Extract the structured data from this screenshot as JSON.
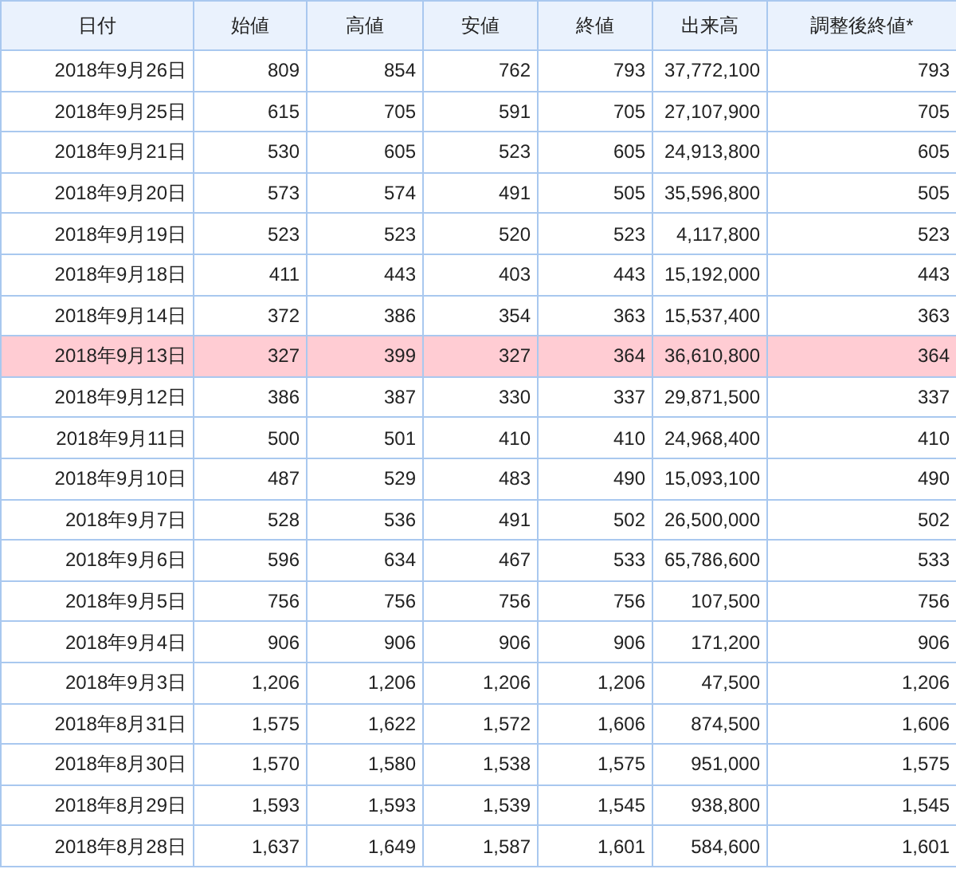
{
  "table": {
    "columns": [
      "日付",
      "始値",
      "高値",
      "安値",
      "終値",
      "出来高",
      "調整後終値*"
    ],
    "rows": [
      {
        "cells": [
          "2018年9月26日",
          "809",
          "854",
          "762",
          "793",
          "37,772,100",
          "793"
        ],
        "highlighted": false
      },
      {
        "cells": [
          "2018年9月25日",
          "615",
          "705",
          "591",
          "705",
          "27,107,900",
          "705"
        ],
        "highlighted": false
      },
      {
        "cells": [
          "2018年9月21日",
          "530",
          "605",
          "523",
          "605",
          "24,913,800",
          "605"
        ],
        "highlighted": false
      },
      {
        "cells": [
          "2018年9月20日",
          "573",
          "574",
          "491",
          "505",
          "35,596,800",
          "505"
        ],
        "highlighted": false
      },
      {
        "cells": [
          "2018年9月19日",
          "523",
          "523",
          "520",
          "523",
          "4,117,800",
          "523"
        ],
        "highlighted": false
      },
      {
        "cells": [
          "2018年9月18日",
          "411",
          "443",
          "403",
          "443",
          "15,192,000",
          "443"
        ],
        "highlighted": false
      },
      {
        "cells": [
          "2018年9月14日",
          "372",
          "386",
          "354",
          "363",
          "15,537,400",
          "363"
        ],
        "highlighted": false
      },
      {
        "cells": [
          "2018年9月13日",
          "327",
          "399",
          "327",
          "364",
          "36,610,800",
          "364"
        ],
        "highlighted": true
      },
      {
        "cells": [
          "2018年9月12日",
          "386",
          "387",
          "330",
          "337",
          "29,871,500",
          "337"
        ],
        "highlighted": false
      },
      {
        "cells": [
          "2018年9月11日",
          "500",
          "501",
          "410",
          "410",
          "24,968,400",
          "410"
        ],
        "highlighted": false
      },
      {
        "cells": [
          "2018年9月10日",
          "487",
          "529",
          "483",
          "490",
          "15,093,100",
          "490"
        ],
        "highlighted": false
      },
      {
        "cells": [
          "2018年9月7日",
          "528",
          "536",
          "491",
          "502",
          "26,500,000",
          "502"
        ],
        "highlighted": false
      },
      {
        "cells": [
          "2018年9月6日",
          "596",
          "634",
          "467",
          "533",
          "65,786,600",
          "533"
        ],
        "highlighted": false
      },
      {
        "cells": [
          "2018年9月5日",
          "756",
          "756",
          "756",
          "756",
          "107,500",
          "756"
        ],
        "highlighted": false
      },
      {
        "cells": [
          "2018年9月4日",
          "906",
          "906",
          "906",
          "906",
          "171,200",
          "906"
        ],
        "highlighted": false
      },
      {
        "cells": [
          "2018年9月3日",
          "1,206",
          "1,206",
          "1,206",
          "1,206",
          "47,500",
          "1,206"
        ],
        "highlighted": false
      },
      {
        "cells": [
          "2018年8月31日",
          "1,575",
          "1,622",
          "1,572",
          "1,606",
          "874,500",
          "1,606"
        ],
        "highlighted": false
      },
      {
        "cells": [
          "2018年8月30日",
          "1,570",
          "1,580",
          "1,538",
          "1,575",
          "951,000",
          "1,575"
        ],
        "highlighted": false
      },
      {
        "cells": [
          "2018年8月29日",
          "1,593",
          "1,593",
          "1,539",
          "1,545",
          "938,800",
          "1,545"
        ],
        "highlighted": false
      },
      {
        "cells": [
          "2018年8月28日",
          "1,637",
          "1,649",
          "1,587",
          "1,601",
          "584,600",
          "1,601"
        ],
        "highlighted": false
      }
    ]
  }
}
